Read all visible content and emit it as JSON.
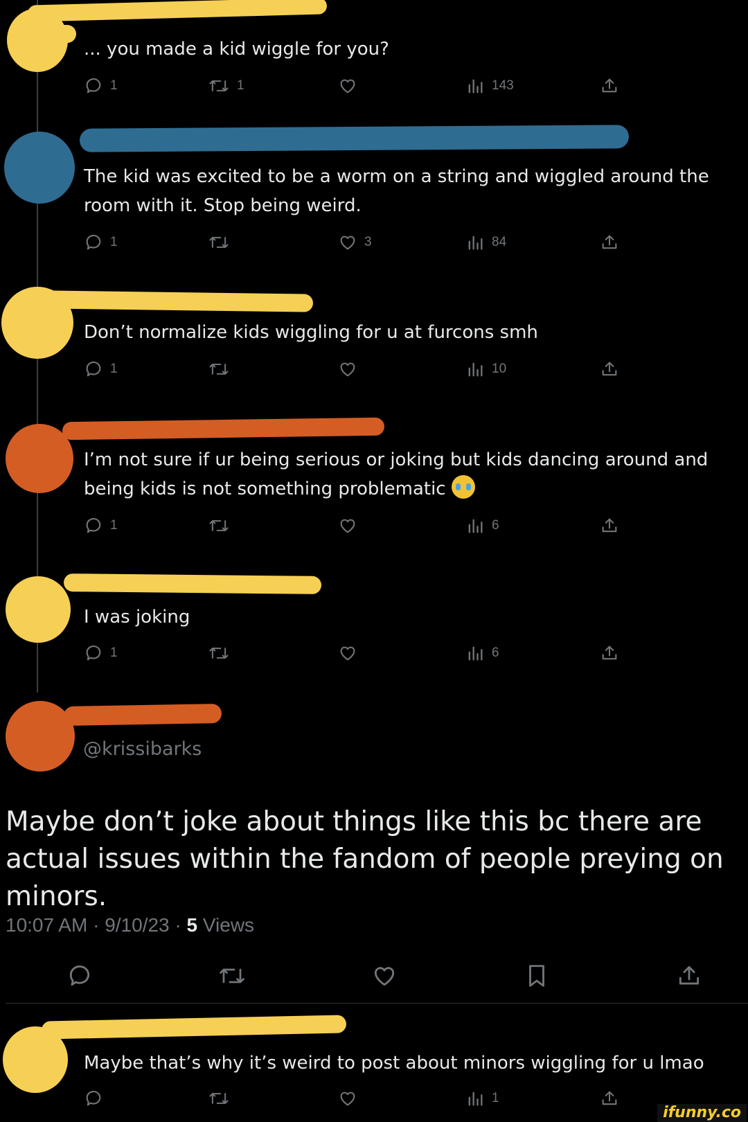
{
  "replies": [
    {
      "text": "... you made a kid wiggle for you?",
      "stats": {
        "replies": "1",
        "retweets": "1",
        "likes": "",
        "views": "143"
      }
    },
    {
      "text": "The kid was excited to be a worm on a string and wiggled around the room with it. Stop being weird.",
      "stats": {
        "replies": "1",
        "retweets": "",
        "likes": "3",
        "views": "84"
      }
    },
    {
      "text": "Don’t normalize kids wiggling for u at furcons smh",
      "stats": {
        "replies": "1",
        "retweets": "",
        "likes": "",
        "views": "10"
      }
    },
    {
      "text": "I’m not sure if ur being serious or joking but kids dancing around and being kids is not something problematic",
      "emoji": "loudly-crying-face",
      "stats": {
        "replies": "1",
        "retweets": "",
        "likes": "",
        "views": "6"
      }
    },
    {
      "text": "I was joking",
      "stats": {
        "replies": "1",
        "retweets": "",
        "likes": "",
        "views": "6"
      }
    }
  ],
  "main_tweet": {
    "handle": "@krissibarks",
    "text": "Maybe don’t joke about things like this bc there are actual issues within the fandom of people preying on minors.",
    "time": "10:07 AM",
    "date": "9/10/23",
    "views_count": "5",
    "views_label": "Views"
  },
  "last_reply": {
    "text": "Maybe that’s why it’s weird to post about minors wiggling for u lmao",
    "stats": {
      "views": "1"
    }
  },
  "watermark": "ifunny.co",
  "colors": {
    "background": "#000000",
    "text": "#e7e9ea",
    "muted": "#71767b",
    "yellow": "#f6cf55",
    "blue": "#2f6c92",
    "orange": "#d45d24"
  }
}
